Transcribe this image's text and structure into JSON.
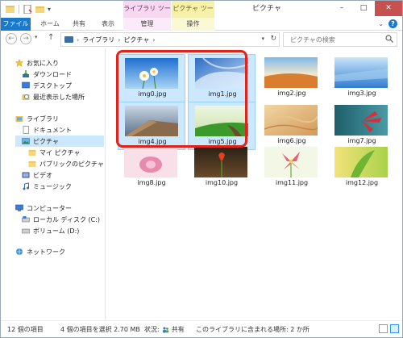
{
  "title_bar": {
    "title": "ピクチャ",
    "context_tab_library": "ライブラリ ツール",
    "context_tab_picture": "ピクチャ ツール",
    "minimize": "–",
    "maximize": "□",
    "close": "✕"
  },
  "ribbon": {
    "file": "ファイル",
    "home": "ホーム",
    "share": "共有",
    "view": "表示",
    "manage_library": "管理",
    "manage_picture": "操作",
    "help": "?"
  },
  "address": {
    "segments": [
      "ライブラリ",
      "ピクチャ"
    ],
    "search_placeholder": "ピクチャの検索"
  },
  "nav_pane": {
    "favorites": "お気に入り",
    "downloads": "ダウンロード",
    "desktop": "デスクトップ",
    "recent": "最近表示した場所",
    "libraries": "ライブラリ",
    "documents": "ドキュメント",
    "pictures": "ピクチャ",
    "my_pictures": "マイ ピクチャ",
    "public_pictures": "パブリックのピクチャ",
    "videos": "ビデオ",
    "music": "ミュージック",
    "computer": "コンピューター",
    "local_disk": "ローカル ディスク (C:)",
    "volume_d": "ボリューム (D:)",
    "network": "ネットワーク"
  },
  "files": [
    {
      "name": "img0.jpg",
      "selected": true
    },
    {
      "name": "img1.jpg",
      "selected": true
    },
    {
      "name": "img2.jpg",
      "selected": false
    },
    {
      "name": "img3.jpg",
      "selected": false
    },
    {
      "name": "img4.jpg",
      "selected": true
    },
    {
      "name": "img5.jpg",
      "selected": true
    },
    {
      "name": "img6.jpg",
      "selected": false
    },
    {
      "name": "img7.jpg",
      "selected": false
    },
    {
      "name": "img8.jpg",
      "selected": false
    },
    {
      "name": "img10.jpg",
      "selected": false
    },
    {
      "name": "img11.jpg",
      "selected": false
    },
    {
      "name": "img12.jpg",
      "selected": false
    }
  ],
  "status": {
    "item_count": "12 個の項目",
    "selection": "4 個の項目を選択  2.70 MB",
    "state": "状況:",
    "shared": "共有",
    "location": "このライブラリに含まれる場所: 2 か所"
  },
  "colors": {
    "accent": "#1979ca",
    "selection_fill": "#cce8ff",
    "highlight_frame": "#e2231a",
    "library_tools_tab": "#f7d8f0",
    "picture_tools_tab": "#f5f1a8"
  }
}
